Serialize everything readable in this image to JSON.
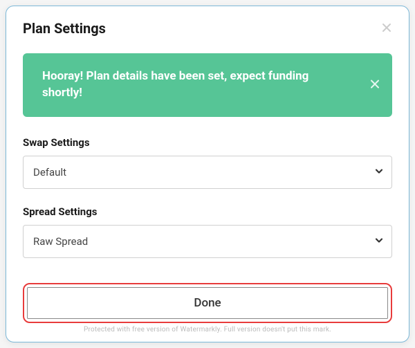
{
  "modal": {
    "title": "Plan Settings"
  },
  "alert": {
    "message": "Hooray! Plan details have been set, expect funding shortly!"
  },
  "swap": {
    "label": "Swap Settings",
    "value": "Default"
  },
  "spread": {
    "label": "Spread Settings",
    "value": "Raw Spread"
  },
  "actions": {
    "done": "Done"
  },
  "watermark": "Protected with free version of Watermarkly. Full version doesn't put this mark."
}
